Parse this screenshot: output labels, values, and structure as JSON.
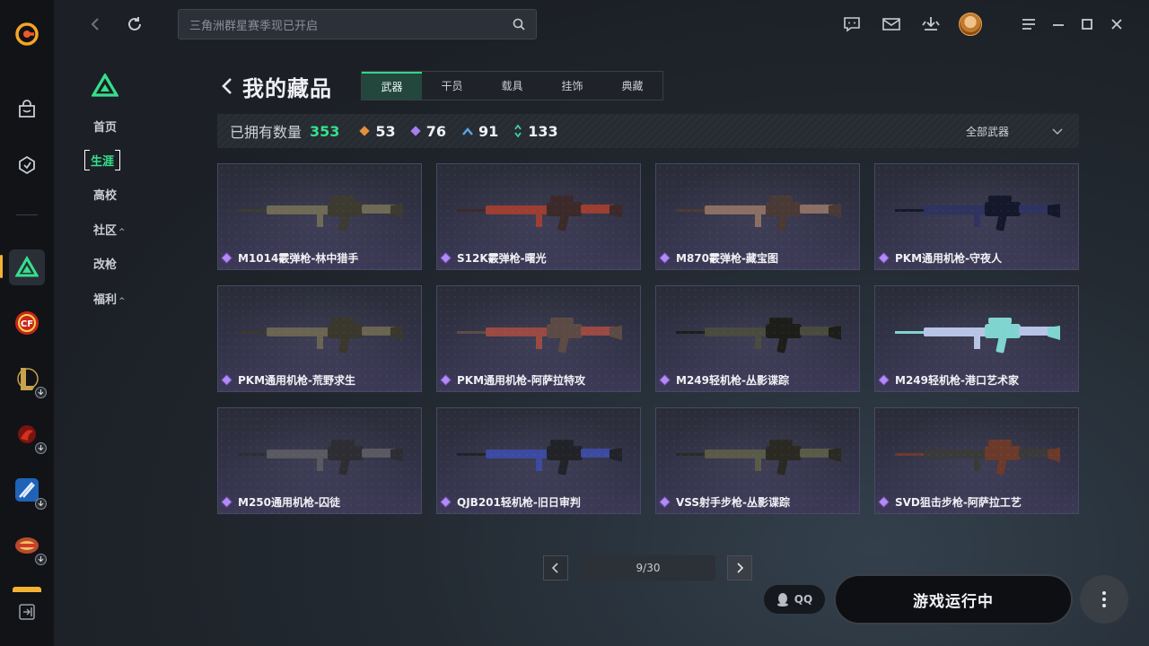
{
  "search": {
    "placeholder": "三角洲群星赛季现已开启"
  },
  "subnav": {
    "items": [
      {
        "label": "首页",
        "caret": ""
      },
      {
        "label": "生涯",
        "caret": ""
      },
      {
        "label": "高校",
        "caret": ""
      },
      {
        "label": "社区",
        "caret": "^"
      },
      {
        "label": "改枪",
        "caret": ""
      },
      {
        "label": "福利",
        "caret": "^"
      }
    ]
  },
  "page": {
    "title": "我的藏品"
  },
  "tabs": [
    "武器",
    "干员",
    "载具",
    "挂饰",
    "典藏"
  ],
  "stats": {
    "owned_label": "已拥有数量",
    "owned_total": "353",
    "counts": [
      {
        "value": "53",
        "color": "#e3913a"
      },
      {
        "value": "76",
        "color": "#a77ff0"
      },
      {
        "value": "91",
        "color": "#5aa6e8"
      },
      {
        "value": "133",
        "color": "#3fd39a"
      }
    ],
    "filter_label": "全部武器"
  },
  "items": [
    {
      "name": "M1014霰弹枪-林中猎手",
      "palette": [
        "#6f6a55",
        "#3d3a30"
      ]
    },
    {
      "name": "S12K霰弹枪-曙光",
      "palette": [
        "#9c3e32",
        "#3b2a29"
      ]
    },
    {
      "name": "M870霰弹枪-藏宝图",
      "palette": [
        "#8c6f64",
        "#4a3a36"
      ]
    },
    {
      "name": "PKM通用机枪-守夜人",
      "palette": [
        "#2e3360",
        "#15172b"
      ]
    },
    {
      "name": "PKM通用机枪-荒野求生",
      "palette": [
        "#6a6452",
        "#3a372c"
      ]
    },
    {
      "name": "PKM通用机枪-阿萨拉特攻",
      "palette": [
        "#9a4a42",
        "#5c4a44"
      ]
    },
    {
      "name": "M249轻机枪-丛影谍踪",
      "palette": [
        "#4a4b3e",
        "#1d1e1a"
      ]
    },
    {
      "name": "M249轻机枪-港口艺术家",
      "palette": [
        "#b8c4e6",
        "#7fd4d0"
      ]
    },
    {
      "name": "M250通用机枪-囚徒",
      "palette": [
        "#5a5860",
        "#2e2d33"
      ]
    },
    {
      "name": "QJB201轻机枪-旧日审判",
      "palette": [
        "#3c4aa0",
        "#222328"
      ]
    },
    {
      "name": "VSS射手步枪-丛影谍踪",
      "palette": [
        "#5a5a48",
        "#2a2a23"
      ]
    },
    {
      "name": "SVD狙击步枪-阿萨拉工艺",
      "palette": [
        "#3a3a3a",
        "#6b3a2a"
      ]
    }
  ],
  "pagination": {
    "label": "9/30"
  },
  "qq": {
    "label": "QQ"
  },
  "launch": {
    "label": "游戏运行中"
  }
}
